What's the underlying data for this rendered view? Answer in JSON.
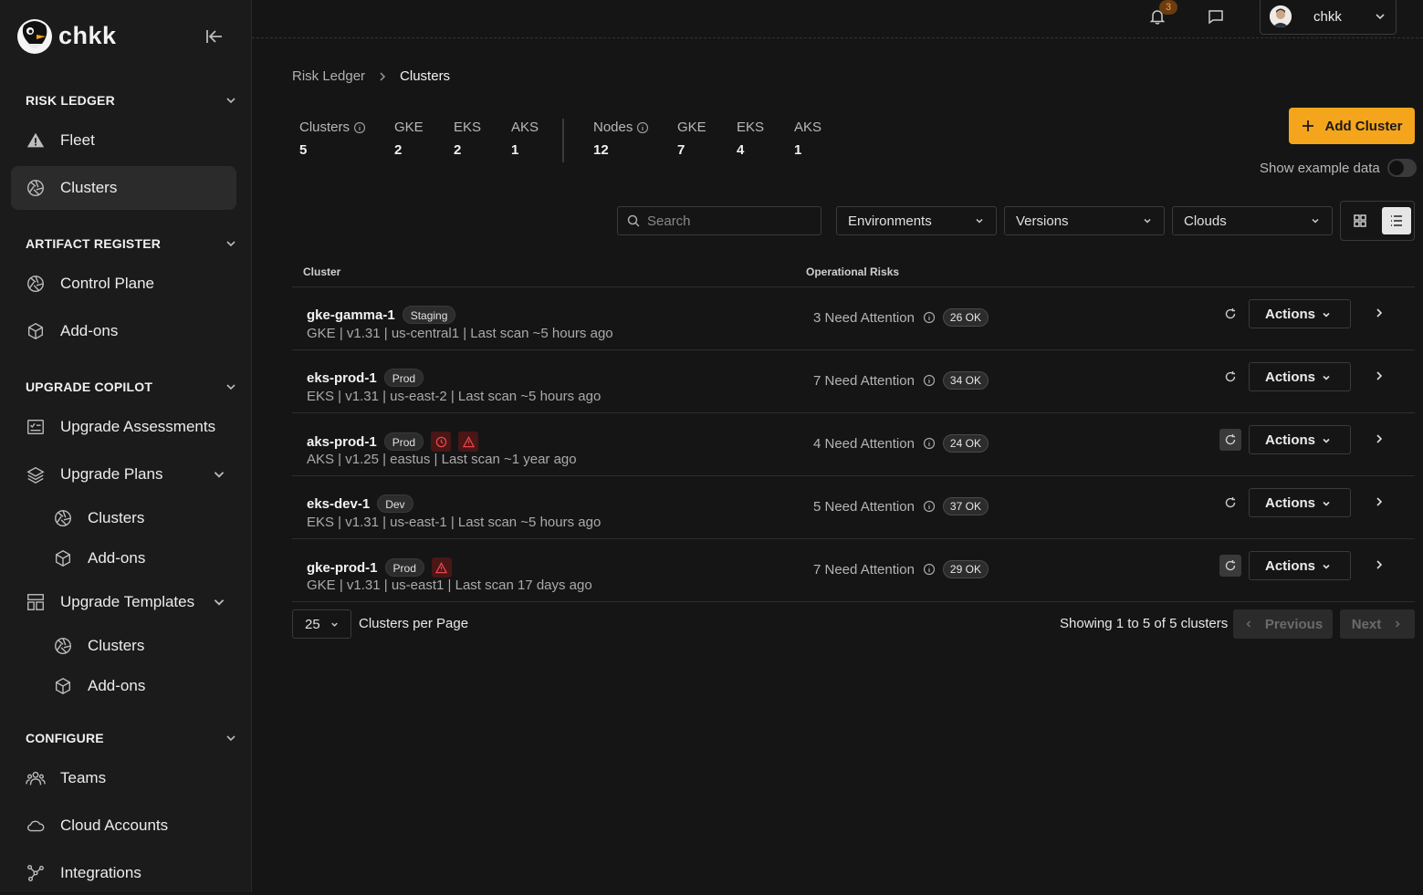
{
  "app": {
    "name": "chkk"
  },
  "sidebar": {
    "sections": [
      {
        "title": "RISK LEDGER",
        "items": [
          {
            "label": "Fleet",
            "icon": "warning-triangle-icon"
          },
          {
            "label": "Clusters",
            "icon": "aperture-icon",
            "active": true
          }
        ]
      },
      {
        "title": "ARTIFACT REGISTER",
        "items": [
          {
            "label": "Control Plane",
            "icon": "aperture-icon"
          },
          {
            "label": "Add-ons",
            "icon": "cube-icon"
          }
        ]
      },
      {
        "title": "UPGRADE COPILOT",
        "items": [
          {
            "label": "Upgrade Assessments",
            "icon": "checklist-icon"
          },
          {
            "label": "Upgrade Plans",
            "icon": "layers-icon",
            "sub": [
              "Clusters",
              "Add-ons"
            ]
          },
          {
            "label": "Upgrade Templates",
            "icon": "layout-icon",
            "sub": [
              "Clusters",
              "Add-ons"
            ]
          }
        ]
      },
      {
        "title": "CONFIGURE",
        "items": [
          {
            "label": "Teams",
            "icon": "users-icon"
          },
          {
            "label": "Cloud Accounts",
            "icon": "cloud-icon"
          },
          {
            "label": "Integrations",
            "icon": "nodes-icon"
          }
        ]
      }
    ]
  },
  "topbar": {
    "notifications_count": "3",
    "user_name": "chkk"
  },
  "breadcrumb": {
    "parent": "Risk Ledger",
    "current": "Clusters"
  },
  "stats": {
    "clusters": {
      "label": "Clusters",
      "value": "5"
    },
    "clusters_gke": {
      "label": "GKE",
      "value": "2"
    },
    "clusters_eks": {
      "label": "EKS",
      "value": "2"
    },
    "clusters_aks": {
      "label": "AKS",
      "value": "1"
    },
    "nodes": {
      "label": "Nodes",
      "value": "12"
    },
    "nodes_gke": {
      "label": "GKE",
      "value": "7"
    },
    "nodes_eks": {
      "label": "EKS",
      "value": "4"
    },
    "nodes_aks": {
      "label": "AKS",
      "value": "1"
    }
  },
  "toolbar": {
    "add_cluster": "Add Cluster",
    "show_example": "Show example data",
    "show_example_on": false,
    "search_placeholder": "Search",
    "environments": "Environments",
    "versions": "Versions",
    "clouds": "Clouds",
    "view_mode": "list"
  },
  "table": {
    "headers": {
      "cluster": "Cluster",
      "risks": "Operational Risks"
    },
    "actions_label": "Actions",
    "rows": [
      {
        "name": "gke-gamma-1",
        "env": "Staging",
        "meta": "GKE | v1.31 | us-central1 | Last scan ~5 hours ago",
        "attention": "3 Need Attention",
        "ok": "26 OK",
        "warnings": [],
        "refresh_disabled": false
      },
      {
        "name": "eks-prod-1",
        "env": "Prod",
        "meta": "EKS | v1.31 | us-east-2 | Last scan ~5 hours ago",
        "attention": "7 Need Attention",
        "ok": "34 OK",
        "warnings": [],
        "refresh_disabled": false
      },
      {
        "name": "aks-prod-1",
        "env": "Prod",
        "meta": "AKS | v1.25 | eastus | Last scan ~1 year ago",
        "attention": "4 Need Attention",
        "ok": "24 OK",
        "warnings": [
          "clock-alert-icon",
          "warning-triangle-icon"
        ],
        "refresh_disabled": true
      },
      {
        "name": "eks-dev-1",
        "env": "Dev",
        "meta": "EKS | v1.31 | us-east-1 | Last scan ~5 hours ago",
        "attention": "5 Need Attention",
        "ok": "37 OK",
        "warnings": [],
        "refresh_disabled": false
      },
      {
        "name": "gke-prod-1",
        "env": "Prod",
        "meta": "GKE | v1.31 | us-east1 | Last scan 17 days ago",
        "attention": "7 Need Attention",
        "ok": "29 OK",
        "warnings": [
          "warning-triangle-icon"
        ],
        "refresh_disabled": true
      }
    ]
  },
  "pagination": {
    "per_page": "25",
    "per_page_label": "Clusters per Page",
    "showing": "Showing 1 to 5 of 5 clusters",
    "previous": "Previous",
    "next": "Next"
  },
  "colors": {
    "accent": "#f5a51b",
    "background": "#151515",
    "sidebar": "#1b1b1b",
    "danger": "#e5484d"
  }
}
